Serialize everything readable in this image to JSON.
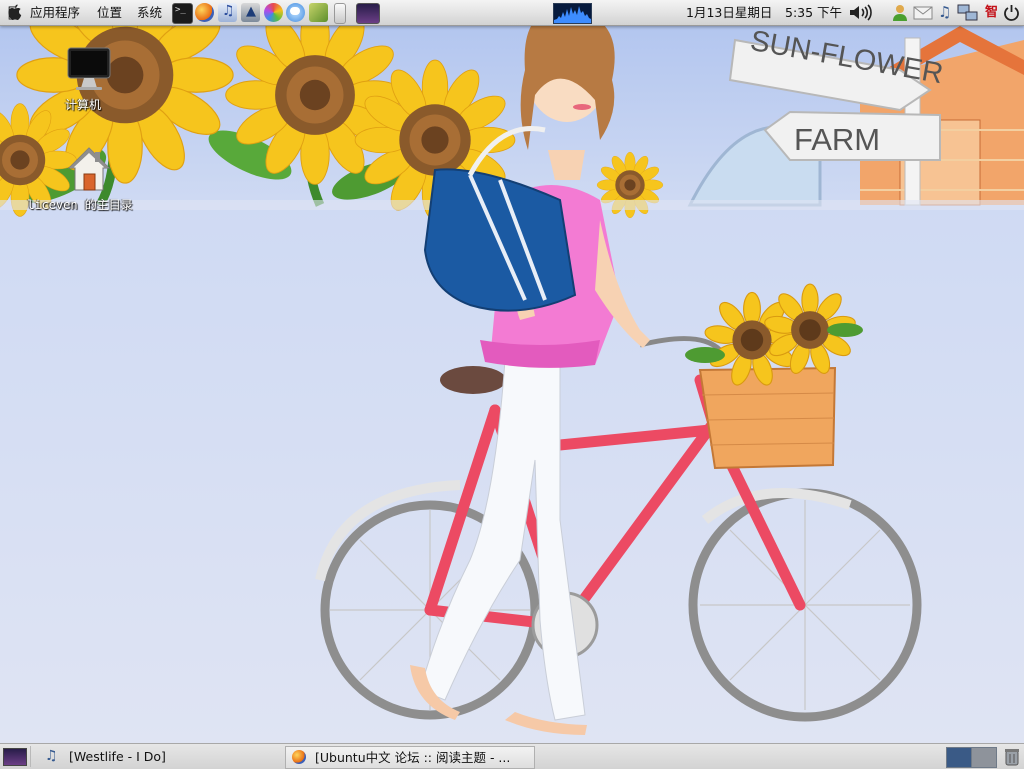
{
  "top_panel": {
    "menus": [
      "应用程序",
      "位置",
      "系统"
    ],
    "clock": "1月13日星期日",
    "time": "5:35 下午",
    "ime_label": "智"
  },
  "launchers": [
    "terminal-icon",
    "firefox-icon",
    "music-player-icon",
    "inkscape-icon",
    "gimp-icon",
    "chat-icon",
    "book-icon",
    "ipod-icon",
    "wallpaper-icon"
  ],
  "desktop": {
    "icons": [
      {
        "name": "computer",
        "label": "计算机"
      },
      {
        "name": "home",
        "label": "liceven 的主目录"
      }
    ],
    "wallpaper_signs": [
      "SUN-FLOWER",
      "FARM"
    ]
  },
  "taskbar": {
    "tasks": [
      {
        "label": "[Westlife - I Do]"
      },
      {
        "label": "[Ubuntu中文 论坛 :: 阅读主题 - ..."
      }
    ]
  },
  "colors": {
    "sky": "#b9c9ef",
    "petal": "#f6c51d",
    "dress": "#f37bd3",
    "bike": "#ec4a63"
  }
}
